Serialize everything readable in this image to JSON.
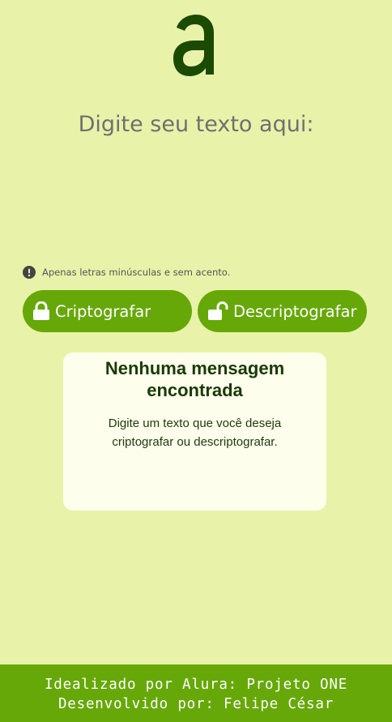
{
  "brand": {
    "logo_icon": "alura-a-logo",
    "color": "#1b4a02"
  },
  "input": {
    "placeholder": "Digite seu texto aqui:",
    "value": ""
  },
  "warning": {
    "icon": "info-circle-icon",
    "text": "Apenas letras minúsculas e sem acento."
  },
  "buttons": {
    "encrypt": {
      "icon": "lock-icon",
      "label": "Criptografar"
    },
    "decrypt": {
      "icon": "unlock-icon",
      "label": "Descriptografar"
    }
  },
  "output": {
    "title": "Nenhuma mensagem encontrada",
    "text": "Digite um texto que você deseja criptografar ou descriptografar."
  },
  "footer": {
    "line1": "Idealizado por Alura: Projeto ONE",
    "line2": "Desenvolvido por: Felipe César"
  },
  "colors": {
    "background": "#e9f2a9",
    "accent": "#66a807",
    "card": "#fdffec",
    "dark_text": "#193a04"
  }
}
